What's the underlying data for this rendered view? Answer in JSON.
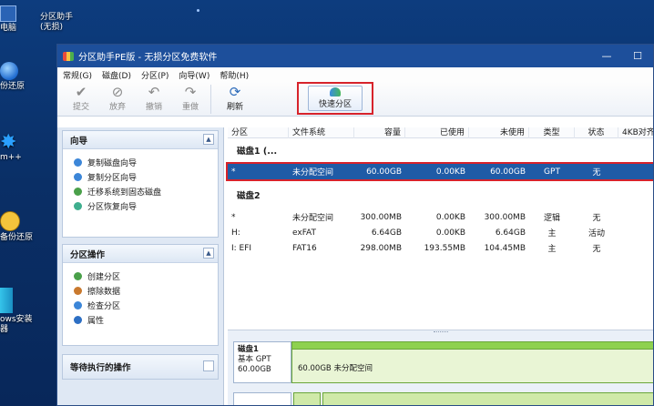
{
  "desktop": {
    "icons": [
      {
        "label": "电脑"
      },
      {
        "label": "分区助手(无损)"
      },
      {
        "label": "份还原"
      },
      {
        "label": "m++"
      },
      {
        "label": "备份还原"
      },
      {
        "label": "ows安装器"
      }
    ]
  },
  "window": {
    "title": "分区助手PE版 - 无损分区免费软件",
    "buttons": {
      "minimize": "—",
      "maximize": "☐"
    },
    "menu": [
      "常规(G)",
      "磁盘(D)",
      "分区(P)",
      "向导(W)",
      "帮助(H)"
    ],
    "toolbar": {
      "submit": "提交",
      "discard": "放弃",
      "undo": "撤销",
      "redo": "重做",
      "refresh": "刷新",
      "quick_partition": "快速分区"
    }
  },
  "sidebar": {
    "wizard": {
      "title": "向导",
      "items": [
        "复制磁盘向导",
        "复制分区向导",
        "迁移系统到固态磁盘",
        "分区恢复向导"
      ]
    },
    "operations": {
      "title": "分区操作",
      "items": [
        "创建分区",
        "擦除数据",
        "检查分区",
        "属性"
      ]
    },
    "pending": {
      "title": "等待执行的操作"
    }
  },
  "table": {
    "columns": [
      "分区",
      "文件系统",
      "容量",
      "已使用",
      "未使用",
      "类型",
      "状态",
      "4KB对齐"
    ],
    "disk1": {
      "title": "磁盘1 (...",
      "rows": [
        {
          "partition": "*",
          "fs": "未分配空间",
          "capacity": "60.00GB",
          "used": "0.00KB",
          "free": "60.00GB",
          "type": "GPT",
          "state": "无"
        }
      ]
    },
    "disk2": {
      "title": "磁盘2",
      "rows": [
        {
          "partition": "*",
          "fs": "未分配空间",
          "capacity": "300.00MB",
          "used": "0.00KB",
          "free": "300.00MB",
          "type": "逻辑",
          "state": "无"
        },
        {
          "partition": "H:",
          "fs": "exFAT",
          "capacity": "6.64GB",
          "used": "0.00KB",
          "free": "6.64GB",
          "type": "主",
          "state": "活动"
        },
        {
          "partition": "I: EFI",
          "fs": "FAT16",
          "capacity": "298.00MB",
          "used": "193.55MB",
          "free": "104.45MB",
          "type": "主",
          "state": "无"
        }
      ]
    }
  },
  "diskmap": {
    "disk1": {
      "name": "磁盘1",
      "type": "基本 GPT",
      "size": "60.00GB",
      "bar_label": "60.00GB 未分配空间"
    }
  },
  "colors": {
    "selection": "#1f5ba6",
    "highlight_border": "#d7232b",
    "titlebar": "#1d4f9b",
    "map_green": "#8ed14f"
  }
}
